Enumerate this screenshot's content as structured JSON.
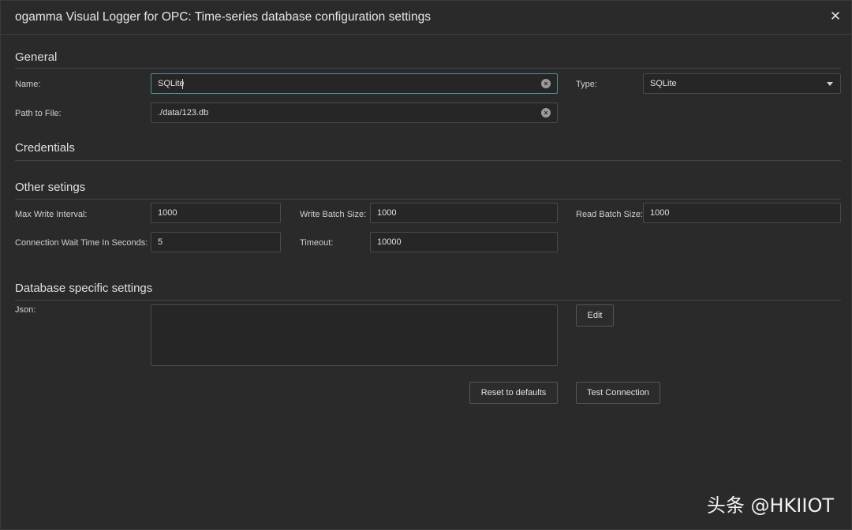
{
  "window": {
    "title": "ogamma Visual Logger for OPC: Time-series database configuration settings"
  },
  "sections": {
    "general": "General",
    "credentials": "Credentials",
    "other": "Other setings",
    "database": "Database specific settings"
  },
  "general": {
    "name_label": "Name:",
    "name_value": "SQLite",
    "type_label": "Type:",
    "type_value": "SQLite",
    "path_label": "Path to File:",
    "path_value": "./data/123.db"
  },
  "other": {
    "max_write_interval_label": "Max Write Interval:",
    "max_write_interval_value": "1000",
    "write_batch_size_label": "Write Batch Size:",
    "write_batch_size_value": "1000",
    "read_batch_size_label": "Read Batch Size:",
    "read_batch_size_value": "1000",
    "connection_wait_label": "Connection Wait Time In Seconds:",
    "connection_wait_value": "5",
    "timeout_label": "Timeout:",
    "timeout_value": "10000"
  },
  "database": {
    "json_label": "Json:",
    "json_value": "",
    "edit_button": "Edit"
  },
  "actions": {
    "reset_button": "Reset to defaults",
    "test_button": "Test Connection"
  },
  "watermark": "头条 @HKIIOT",
  "icons": {
    "close": "close-icon",
    "clear": "clear-icon",
    "dropdown": "chevron-down-icon"
  },
  "colors": {
    "background": "#2a2a2a",
    "focus_border": "#4f8f9a"
  }
}
